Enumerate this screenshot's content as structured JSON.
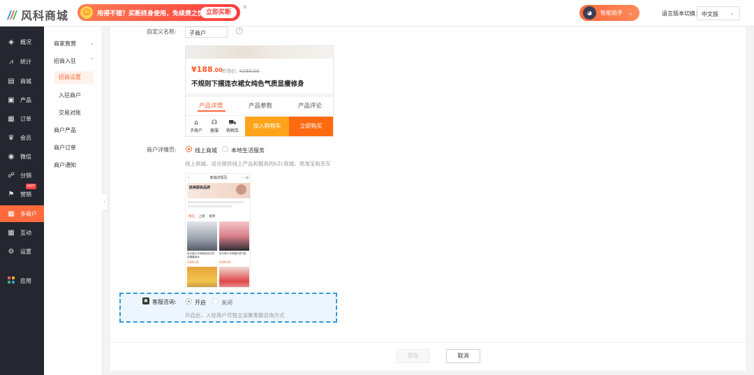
{
  "header": {
    "brand": "风科商城",
    "promo_text": "用得不错？买断终身使用，免续费之忧！",
    "promo_button": "立即买断",
    "assistant_label": "智能助手",
    "lang_label": "语言版本切换：",
    "lang_value": "中文版"
  },
  "sidebar": {
    "items": [
      {
        "label": "概况",
        "icon": "layers-icon",
        "glyph": "◈"
      },
      {
        "label": "统计",
        "icon": "chart-icon",
        "glyph": "📈"
      },
      {
        "label": "商城",
        "icon": "store-icon",
        "glyph": "▤"
      },
      {
        "label": "产品",
        "icon": "product-icon",
        "glyph": "▣"
      },
      {
        "label": "订单",
        "icon": "order-icon",
        "glyph": "▦"
      },
      {
        "label": "会员",
        "icon": "crown-icon",
        "glyph": "♛"
      },
      {
        "label": "微信",
        "icon": "wechat-icon",
        "glyph": "◉"
      },
      {
        "label": "分销",
        "icon": "distribution-icon",
        "glyph": "☍"
      },
      {
        "label": "营销",
        "icon": "flag-icon",
        "glyph": "⚑",
        "badge": "HOT"
      },
      {
        "label": "多商户",
        "icon": "multi-merchant-icon",
        "glyph": "▩"
      },
      {
        "label": "互动",
        "icon": "interact-icon",
        "glyph": "▦"
      },
      {
        "label": "设置",
        "icon": "gear-icon",
        "glyph": "⚙"
      },
      {
        "label": "应用",
        "icon": "apps-icon",
        "glyph": "▪"
      }
    ]
  },
  "subnav": {
    "merchant_direct": "商家直营",
    "recruit": "招商入驻",
    "recruit_settings": "招商设置",
    "joined_merchants": "入驻商户",
    "reconciliation": "交易对账",
    "merchant_products": "商户产品",
    "merchant_orders": "商户订单",
    "merchant_notice": "商户通知"
  },
  "form": {
    "custom_name_label": "自定义名称:",
    "custom_name_value": "子商户",
    "detail_label": "商户详情页:",
    "option_online": "线上商城",
    "option_local": "本地生活服务",
    "detail_hint": "线上商城，适合提供线上产品和服务的b2c商城，类淘宝和京东",
    "service_label": "客服咨询:",
    "service_on": "开启",
    "service_off": "关闭",
    "service_hint": "开启后，入驻商户可独立设置客服咨询方式"
  },
  "product_card": {
    "currency": "¥",
    "price": "188",
    "price_decimal": ".00",
    "market_label": "市场价:",
    "market_price": "¥288.00",
    "title": "不规则下摆连衣裙女纯色气质显瘦修身",
    "tabs": [
      "产品详情",
      "产品参数",
      "产品评论"
    ],
    "mini_actions": [
      {
        "label": "子商户",
        "icon": "shop-icon",
        "glyph": "⌂"
      },
      {
        "label": "客服",
        "icon": "headset-icon",
        "glyph": "☊"
      },
      {
        "label": "购物车",
        "icon": "cart-icon",
        "glyph": "🛒"
      }
    ],
    "add_cart": "加入购物车",
    "buy_now": "立即购买"
  },
  "phone": {
    "title": "商城详情页",
    "shop_name": "欧美服装品牌",
    "tabs": [
      "精选",
      "上新",
      "榜单"
    ],
    "products": [
      {
        "caption": "设计感小众休闲运动卫衣连帽套装女",
        "price": "¥399.00"
      },
      {
        "caption": "设计感小众短袖印花T恤",
        "price": "¥299.00"
      }
    ]
  },
  "footer": {
    "save": "保存",
    "cancel": "取消"
  },
  "colors": {
    "accent": "#ff6a3d",
    "sidebar_bg": "#24272f",
    "selection_border": "#2f9ad7"
  }
}
